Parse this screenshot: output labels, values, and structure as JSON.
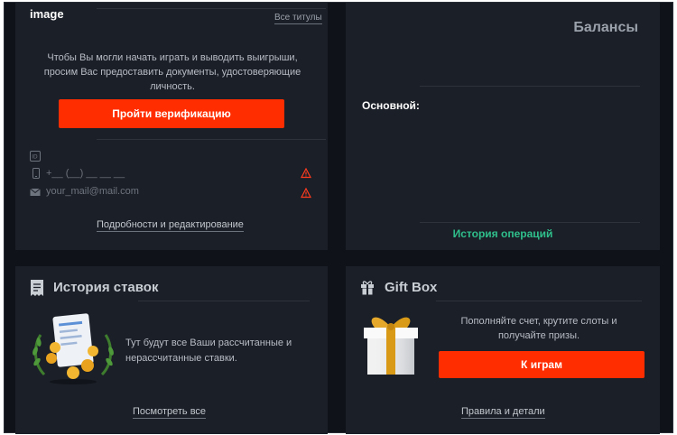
{
  "header": {
    "image_label": "image",
    "all_titles_link": "Все титулы"
  },
  "verification": {
    "message": "Чтобы Вы могли начать играть и выводить выигрыши, просим Вас предоставить документы, удостоверяющие личность.",
    "button_label": "Пройти верификацию",
    "phone_placeholder": "+__ (__) __ __ __",
    "email_placeholder": "your_mail@mail.com",
    "details_link": "Подробности и редактирование"
  },
  "balances": {
    "title": "Балансы",
    "main_label": "Основной:",
    "history_link": "История операций"
  },
  "bets": {
    "title": "История ставок",
    "message": "Тут будут все Ваши рассчитанные и нерассчитанные ставки.",
    "view_all_link": "Посмотреть все"
  },
  "giftbox": {
    "title": "Gift Box",
    "message": "Пополняйте счет, крутите слоты и получайте призы.",
    "button_label": "К играм",
    "rules_link": "Правила и детали"
  },
  "colors": {
    "accent_red": "#ff2d00",
    "accent_green": "#2fbf8c",
    "background": "#0f1218",
    "card": "#1b1f27"
  }
}
